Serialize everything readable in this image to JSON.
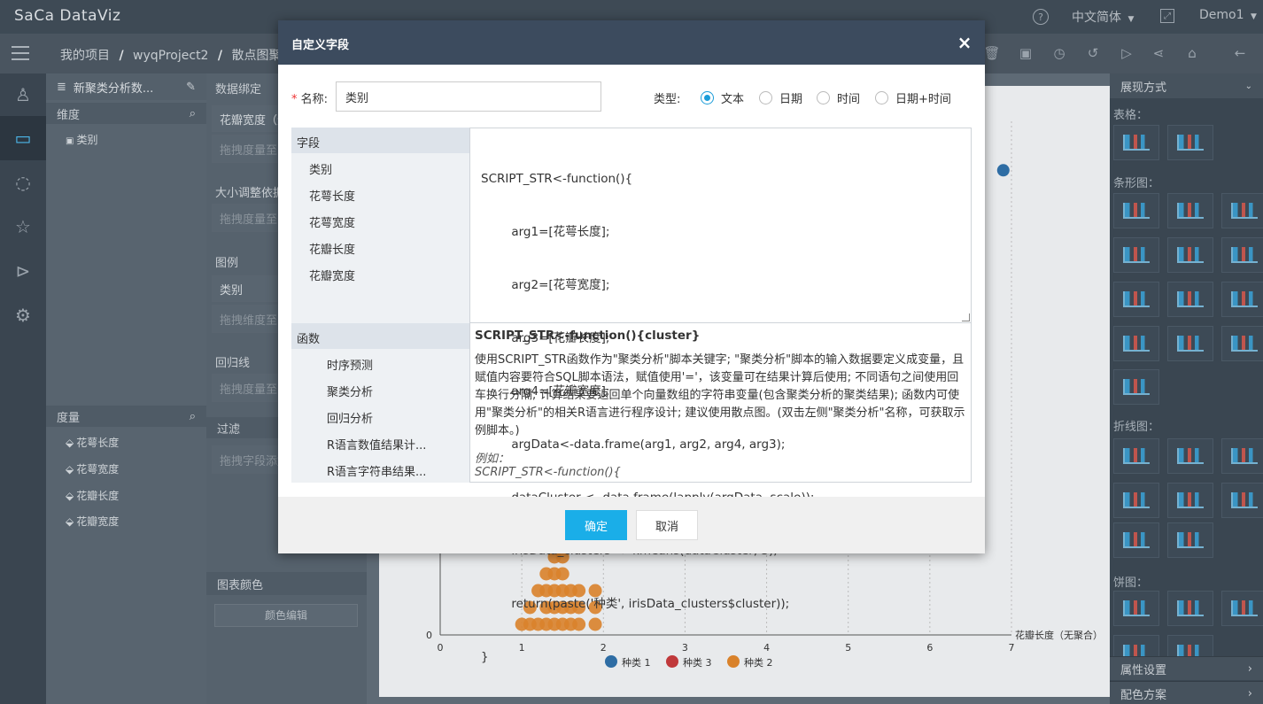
{
  "app": {
    "logo": "SaCa DataViz",
    "language": "中文简体",
    "user": "Demo1"
  },
  "breadcrumb": {
    "b1": "我的项目",
    "b2": "wyqProject2",
    "b3": "散点图聚类"
  },
  "left": {
    "dataset": "新聚类分析数...",
    "dimension_title": "维度",
    "dimensions": [
      "类别"
    ],
    "measure_title": "度量",
    "measures": [
      "花萼长度",
      "花萼宽度",
      "花瓣长度",
      "花瓣宽度"
    ]
  },
  "binding": {
    "title": "数据绑定",
    "x_field": "花瓣宽度（无",
    "drag_measure": "拖拽度量至",
    "size_title": "大小调整依据",
    "legend_title": "图例",
    "legend_field": "类别",
    "drag_dimension": "拖拽维度至",
    "regression_title": "回归线",
    "filter_title": "过滤",
    "drag_field": "拖拽字段添加",
    "chart_color_title": "图表颜色",
    "color_edit": "颜色编辑"
  },
  "chart": {
    "x_axis_label": "花瓣长度（无聚合）",
    "x_ticks": [
      "0",
      "1",
      "2",
      "3",
      "4",
      "5",
      "6",
      "7"
    ],
    "y_zero": "0",
    "legend": [
      {
        "name": "种类 1",
        "color": "#2e6da4"
      },
      {
        "name": "种类 3",
        "color": "#c0393b"
      },
      {
        "name": "种类 2",
        "color": "#d9822b"
      }
    ],
    "points_orange": [
      [
        1.0,
        0
      ],
      [
        1.1,
        0
      ],
      [
        1.2,
        0
      ],
      [
        1.3,
        0
      ],
      [
        1.4,
        0
      ],
      [
        1.5,
        0
      ],
      [
        1.6,
        0
      ],
      [
        1.7,
        0
      ],
      [
        1.9,
        0
      ],
      [
        1.1,
        1
      ],
      [
        1.3,
        1
      ],
      [
        1.4,
        1
      ],
      [
        1.5,
        1
      ],
      [
        1.6,
        1
      ],
      [
        1.7,
        1
      ],
      [
        1.9,
        1
      ],
      [
        1.2,
        2
      ],
      [
        1.3,
        2
      ],
      [
        1.4,
        2
      ],
      [
        1.5,
        2
      ],
      [
        1.6,
        2
      ],
      [
        1.7,
        2
      ],
      [
        1.9,
        2
      ],
      [
        1.3,
        3
      ],
      [
        1.4,
        3
      ],
      [
        1.5,
        3
      ],
      [
        1.4,
        4
      ],
      [
        1.5,
        4
      ]
    ],
    "point_blue": [
      6.9,
      99
    ]
  },
  "right": {
    "title": "展现方式",
    "table_label": "表格：",
    "bar_label": "条形图：",
    "line_label": "折线图：",
    "pie_label": "饼图：",
    "props": "属性设置",
    "colors": "配色方案"
  },
  "modal": {
    "title": "自定义字段",
    "name_label": "名称:",
    "name_value": "类别",
    "type_label": "类型:",
    "types": [
      "文本",
      "日期",
      "时间",
      "日期+时间"
    ],
    "fields_title": "字段",
    "fields": [
      "类别",
      "花萼长度",
      "花萼宽度",
      "花瓣长度",
      "花瓣宽度"
    ],
    "func_title": "函数",
    "funcs": [
      "时序预测",
      "聚类分析",
      "回归分析",
      "R语言数值结果计...",
      "R语言字符串结果..."
    ],
    "script": [
      "SCRIPT_STR<-function(){",
      "        arg1=[花萼长度];",
      "        arg2=[花萼宽度];",
      "        arg3=[花瓣长度];",
      "        arg4=[花瓣宽度];",
      "        argData<-data.frame(arg1, arg2, arg4, arg3);",
      "        dataCluster <- data.frame(lapply(argData, scale));",
      "        irisData_clusters <- kmeans(dataCluster, 3);",
      "        return(paste('种类', irisData_clusters$cluster));",
      "}"
    ],
    "help_title": "SCRIPT_STR<-function(){cluster}",
    "help_text": "使用SCRIPT_STR函数作为\"聚类分析\"脚本关键字; \"聚类分析\"脚本的输入数据要定义成变量，且赋值内容要符合SQL脚本语法，赋值使用'='，该变量可在结果计算后使用; 不同语句之间使用回车换行分隔; 计算结果要返回单个向量数组的字符串变量(包含聚类分析的聚类结果); 函数内可使用\"聚类分析\"的相关R语言进行程序设计; 建议使用散点图。(双击左侧\"聚类分析\"名称，可获取示例脚本。)",
    "example_label": "例如：",
    "example_line": "SCRIPT_STR<-function(){",
    "ok": "确定",
    "cancel": "取消"
  }
}
